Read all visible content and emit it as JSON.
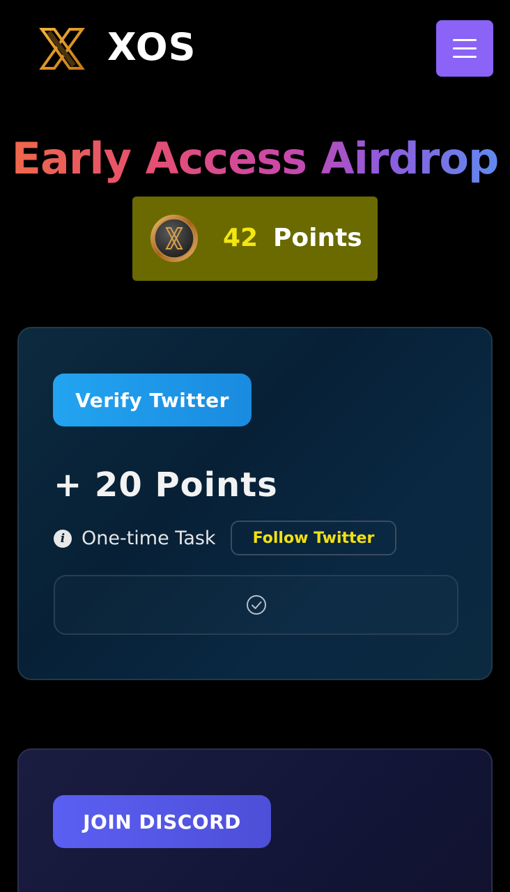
{
  "header": {
    "brand": "XOS",
    "menu_icon": "hamburger-icon"
  },
  "hero": {
    "title": "Early Access Airdrop",
    "points_value": "42",
    "points_label": "Points"
  },
  "tasks": [
    {
      "button_label": "Verify Twitter",
      "reward": "+ 20 Points",
      "type": "One-time Task",
      "link_label": "Follow Twitter",
      "status_icon": "check-circle-icon"
    },
    {
      "button_label": "JOIN DISCORD"
    }
  ],
  "colors": {
    "menu_button": "#8b63f6",
    "points_badge": "#6a6a00",
    "points_value": "#f4e610",
    "twitter_button": "#1f9aec",
    "discord_button": "#5456e6",
    "follow_text": "#f1e013"
  }
}
